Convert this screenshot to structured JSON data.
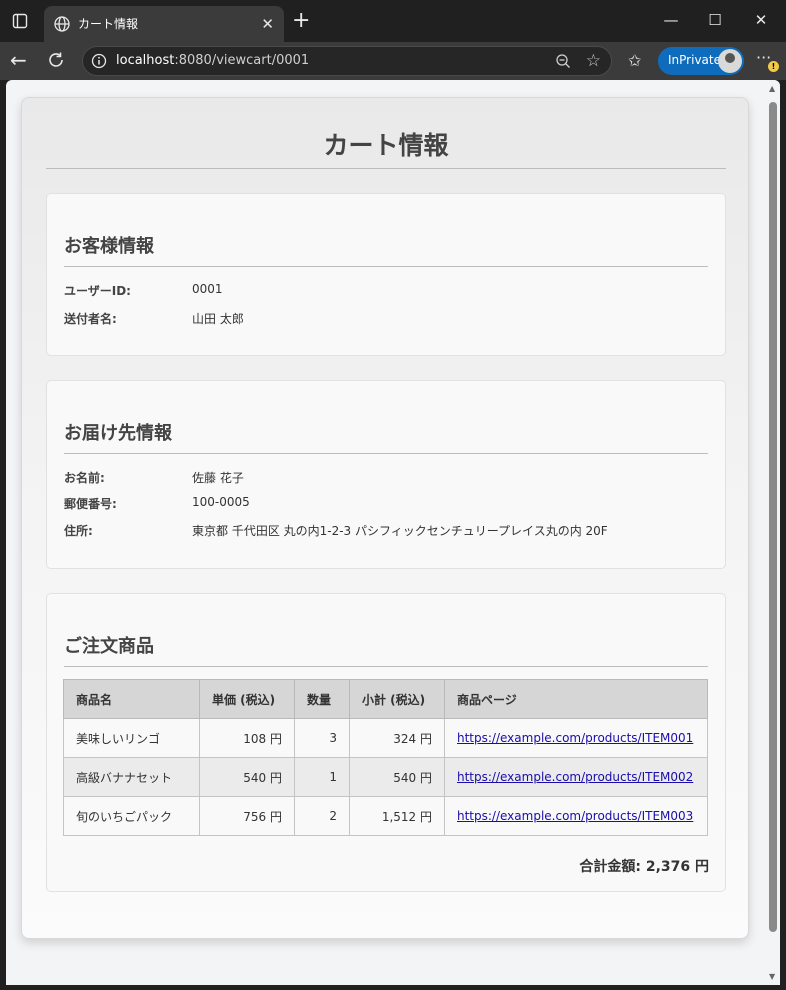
{
  "browser": {
    "tab_title": "カート情報",
    "url_host": "localhost",
    "url_path": ":8080/viewcart/0001",
    "inprivate_label": "InPrivate"
  },
  "page": {
    "title": "カート情報"
  },
  "customer": {
    "heading": "お客様情報",
    "fields": [
      {
        "label": "ユーザーID:",
        "value": "0001"
      },
      {
        "label": "送付者名:",
        "value": "山田 太郎"
      }
    ]
  },
  "shipping": {
    "heading": "お届け先情報",
    "fields": [
      {
        "label": "お名前:",
        "value": "佐藤 花子"
      },
      {
        "label": "郵便番号:",
        "value": "100-0005"
      },
      {
        "label": "住所:",
        "value": "東京都 千代田区 丸の内1-2-3 パシフィックセンチュリープレイス丸の内 20F"
      }
    ]
  },
  "order": {
    "heading": "ご注文商品",
    "columns": [
      "商品名",
      "単価 (税込)",
      "数量",
      "小計 (税込)",
      "商品ページ"
    ],
    "rows": [
      {
        "name": "美味しいリンゴ",
        "price": "108 円",
        "qty": "3",
        "subtotal": "324 円",
        "link": "https://example.com/products/ITEM001"
      },
      {
        "name": "高級バナナセット",
        "price": "540 円",
        "qty": "1",
        "subtotal": "540 円",
        "link": "https://example.com/products/ITEM002"
      },
      {
        "name": "旬のいちごパック",
        "price": "756 円",
        "qty": "2",
        "subtotal": "1,512 円",
        "link": "https://example.com/products/ITEM003"
      }
    ],
    "total": "合計金額: 2,376 円"
  }
}
